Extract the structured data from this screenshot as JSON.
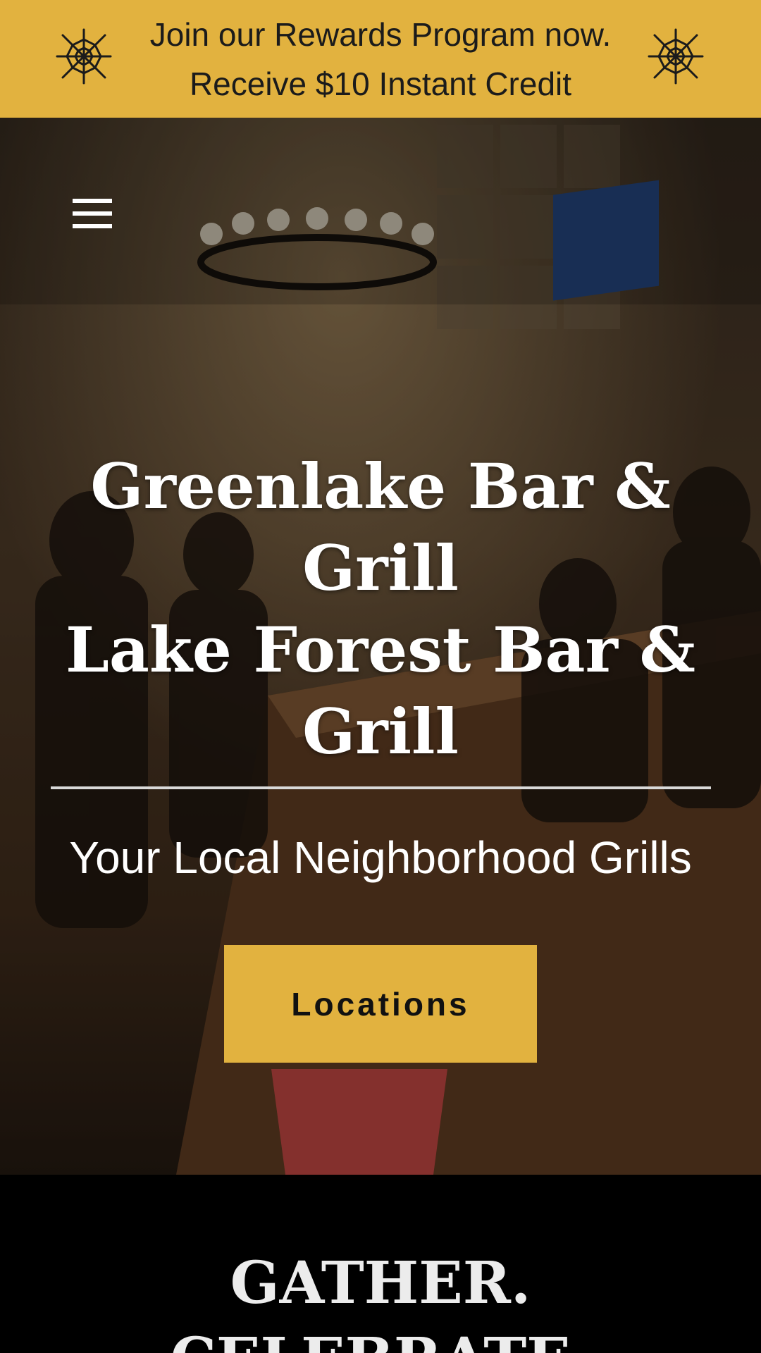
{
  "promo": {
    "line1": "Join our Rewards Program now.",
    "line2": "Receive $10 Instant Credit",
    "background": "#e2b23f",
    "icon": "spider-web-icon"
  },
  "nav": {
    "menu_icon": "hamburger-menu-icon"
  },
  "hero": {
    "title_line1": "Greenlake Bar &",
    "title_line2": "Grill",
    "title_line3": "Lake Forest Bar &",
    "title_line4": "Grill",
    "tagline": "Your Local Neighborhood Grills",
    "cta_label": "Locations",
    "cta_color": "#e2b23f"
  },
  "section": {
    "heading_line1": "GATHER.",
    "heading_line2": "CELEBRATE."
  }
}
